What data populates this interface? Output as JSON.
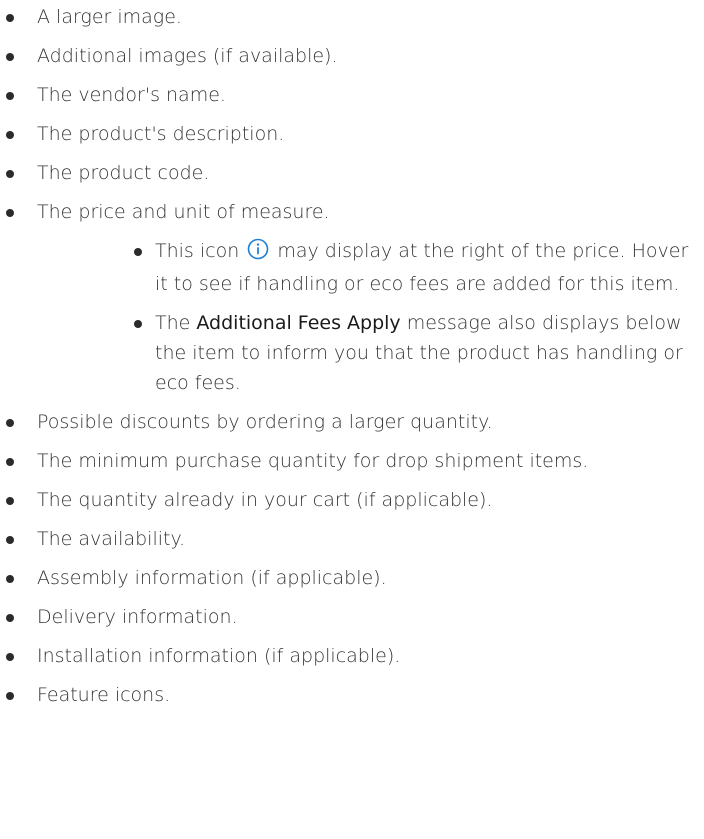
{
  "items": [
    "A larger image.",
    "Additional images (if available).",
    "The vendor's name.",
    "The product's description.",
    "The product code.",
    "The price and unit of measure."
  ],
  "sub_items": {
    "icon_line": {
      "before": "This icon",
      "icon": "info-circle-icon",
      "after": "may display at the right of the price. Hover it to see if handling or eco fees are added for this item."
    },
    "fees_line": {
      "before": "The",
      "strong": "Additional Fees Apply",
      "after": "message also displays below the item to inform you that the product has handling or eco fees."
    }
  },
  "items_after": [
    "Possible discounts by ordering a larger quantity.",
    "The minimum purchase quantity for drop shipment items.",
    "The quantity already in your cart (if applicable).",
    "The availability.",
    "Assembly information (if applicable).",
    "Delivery information.",
    "Installation information (if applicable).",
    "Feature icons."
  ],
  "colors": {
    "text": "#333333",
    "icon": "#1e7fd6"
  }
}
